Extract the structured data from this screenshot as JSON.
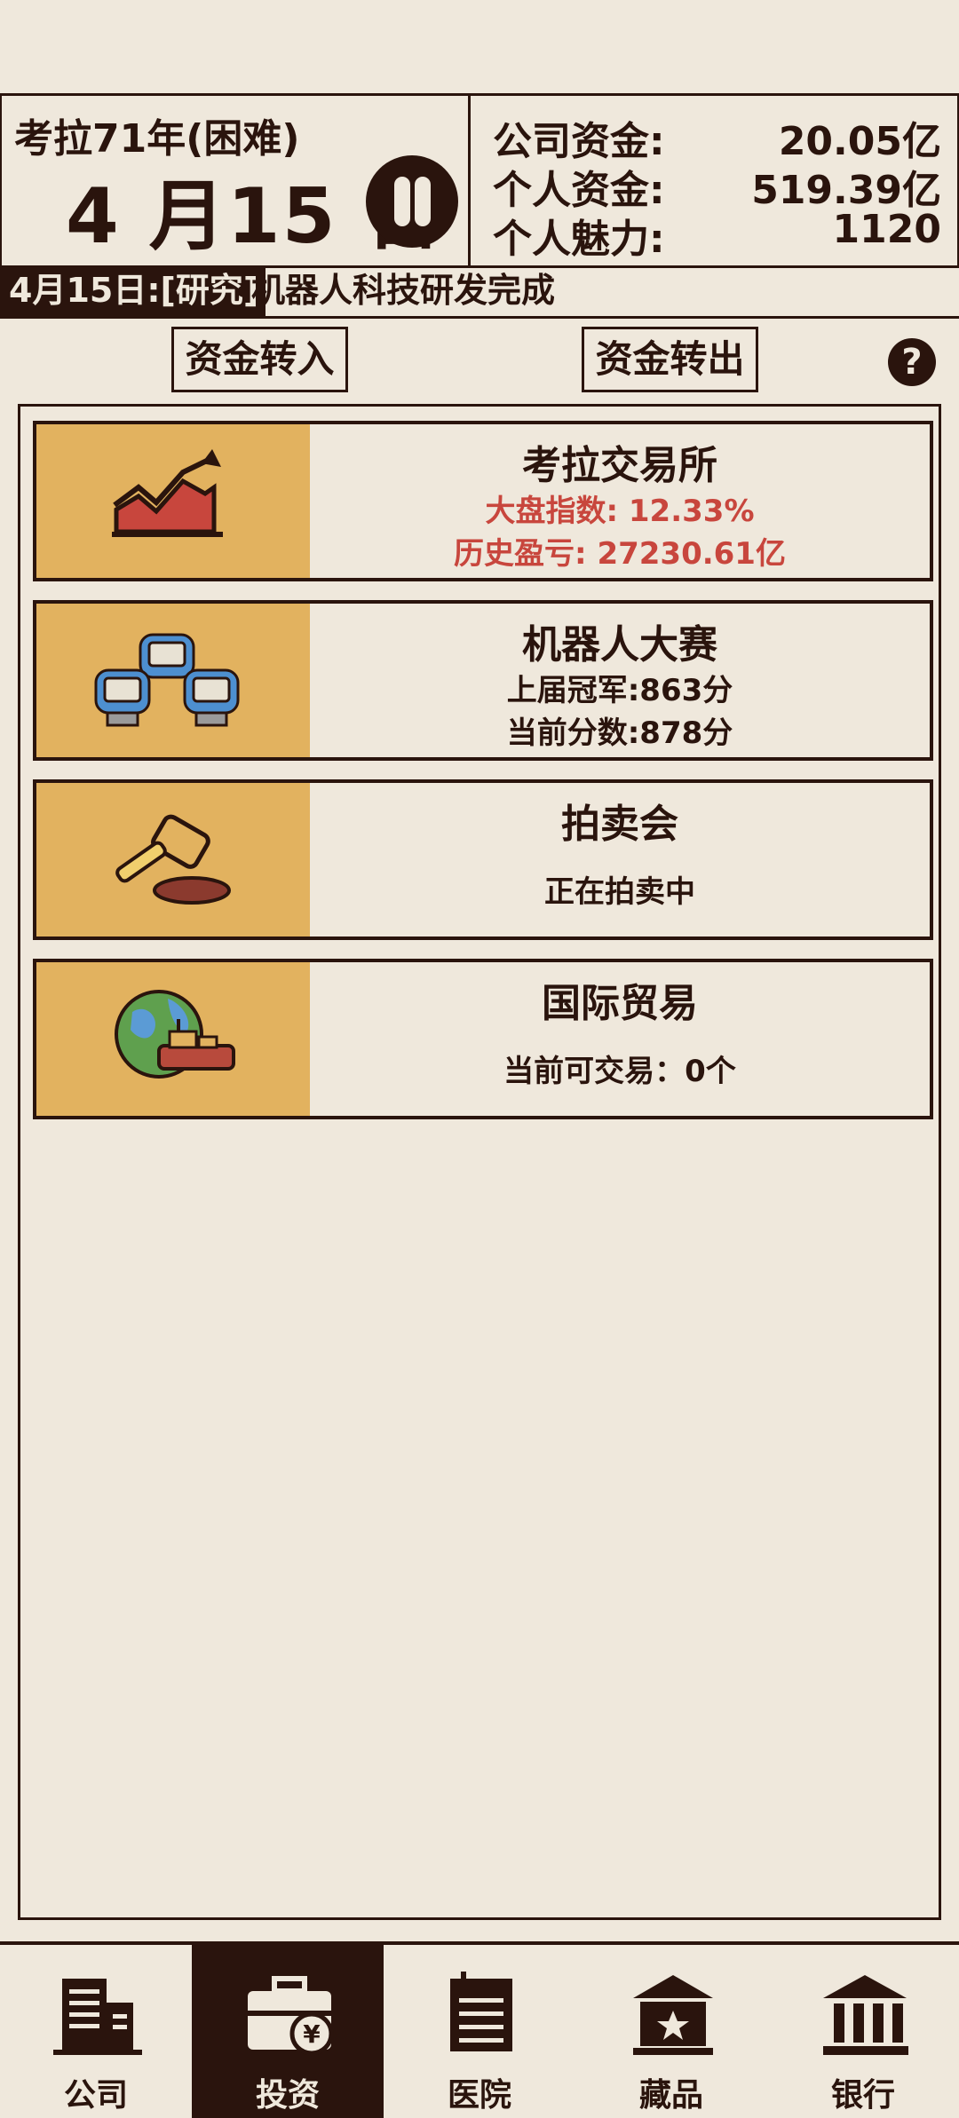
{
  "header": {
    "year_label": "考拉71年(困难)",
    "date": "4 月15 日",
    "company_funds_label": "公司资金:",
    "company_funds_value": "20.05亿",
    "personal_funds_label": "个人资金:",
    "personal_funds_value": "519.39亿",
    "charm_label": "个人魅力:",
    "charm_value": "1120"
  },
  "ticker": {
    "date_tag": "4月15日:[研究]",
    "message": "机器人科技研发完成"
  },
  "actions": {
    "transfer_in": "资金转入",
    "transfer_out": "资金转出",
    "help_icon": "?"
  },
  "cards": [
    {
      "title": "考拉交易所",
      "line1": "大盘指数: 12.33%",
      "line2": "历史盈亏: 27230.61亿",
      "icon": "stock-chart-icon",
      "accent": "#c8463d"
    },
    {
      "title": "机器人大赛",
      "line1": "上届冠军:863分",
      "line2": "当前分数:878分",
      "icon": "robots-icon"
    },
    {
      "title": "拍卖会",
      "line1": "正在拍卖中",
      "line2": "",
      "icon": "auction-gavel-icon"
    },
    {
      "title": "国际贸易",
      "line1": "当前可交易：0个",
      "line2": "",
      "icon": "globe-ship-icon"
    }
  ],
  "nav": [
    {
      "label": "公司",
      "icon": "building-icon",
      "active": false
    },
    {
      "label": "投资",
      "icon": "briefcase-yen-icon",
      "active": true
    },
    {
      "label": "医院",
      "icon": "hospital-icon",
      "active": false
    },
    {
      "label": "藏品",
      "icon": "museum-star-icon",
      "active": false
    },
    {
      "label": "银行",
      "icon": "bank-icon",
      "active": false
    }
  ],
  "colors": {
    "background": "#efe8dc",
    "dark": "#2a140d",
    "tile": "#e2b25f",
    "accent_red": "#c8463d"
  }
}
